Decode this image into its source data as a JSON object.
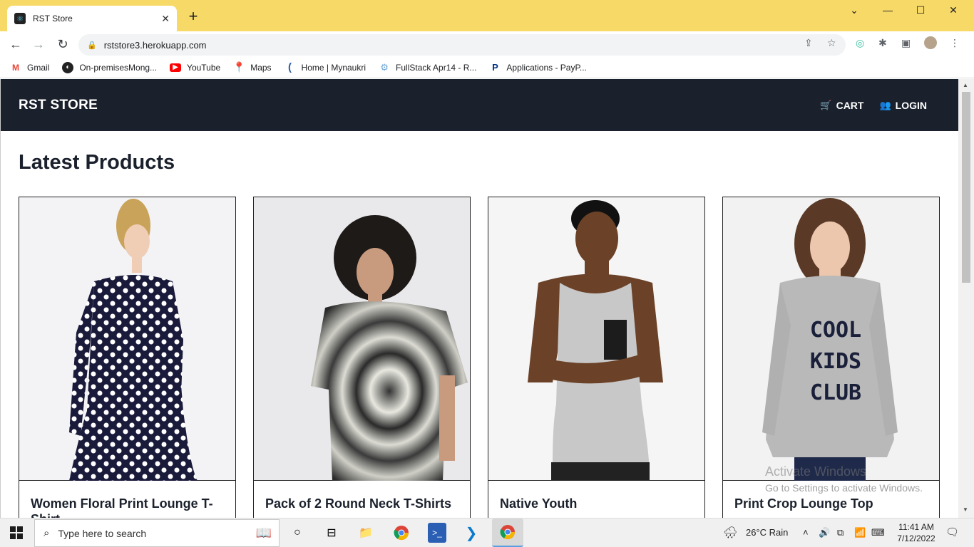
{
  "browser": {
    "tab_title": "RST Store",
    "url": "rststore3.herokuapp.com",
    "bookmarks": [
      {
        "label": "Gmail",
        "icon": "gmail-icon",
        "color": "#ea4335"
      },
      {
        "label": "On-premisesMong...",
        "icon": "globe-icon",
        "color": "#222222"
      },
      {
        "label": "YouTube",
        "icon": "youtube-icon",
        "color": "#ff0000"
      },
      {
        "label": "Maps",
        "icon": "maps-pin-icon",
        "color": "#34a853"
      },
      {
        "label": "Home | Mynaukri",
        "icon": "naukri-icon",
        "color": "#2b5ea7"
      },
      {
        "label": "FullStack Apr14 - R...",
        "icon": "fullstack-icon",
        "color": "#6aa3d8"
      },
      {
        "label": "Applications - PayP...",
        "icon": "paypal-icon",
        "color": "#003087"
      }
    ]
  },
  "navbar": {
    "brand": "RST STORE",
    "cart_label": "CART",
    "login_label": "LOGIN",
    "background": "#1b212c"
  },
  "main": {
    "heading": "Latest Products",
    "products": [
      {
        "name": "Women Floral Print Lounge T-Shirt",
        "image": "woman-polka-dot-dress-photo"
      },
      {
        "name": "Pack of 2 Round Neck T-Shirts",
        "image": "man-tie-dye-tshirt-photo"
      },
      {
        "name": "Native Youth",
        "image": "man-grey-tank-top-photo"
      },
      {
        "name": "Print Crop Lounge Top",
        "image": "woman-cool-kids-club-sweater-photo"
      }
    ]
  },
  "watermark": {
    "title": "Activate Windows",
    "subtitle": "Go to Settings to activate Windows."
  },
  "taskbar": {
    "search_placeholder": "Type here to search",
    "weather": "26°C  Rain",
    "time": "11:41 AM",
    "date": "7/12/2022"
  }
}
